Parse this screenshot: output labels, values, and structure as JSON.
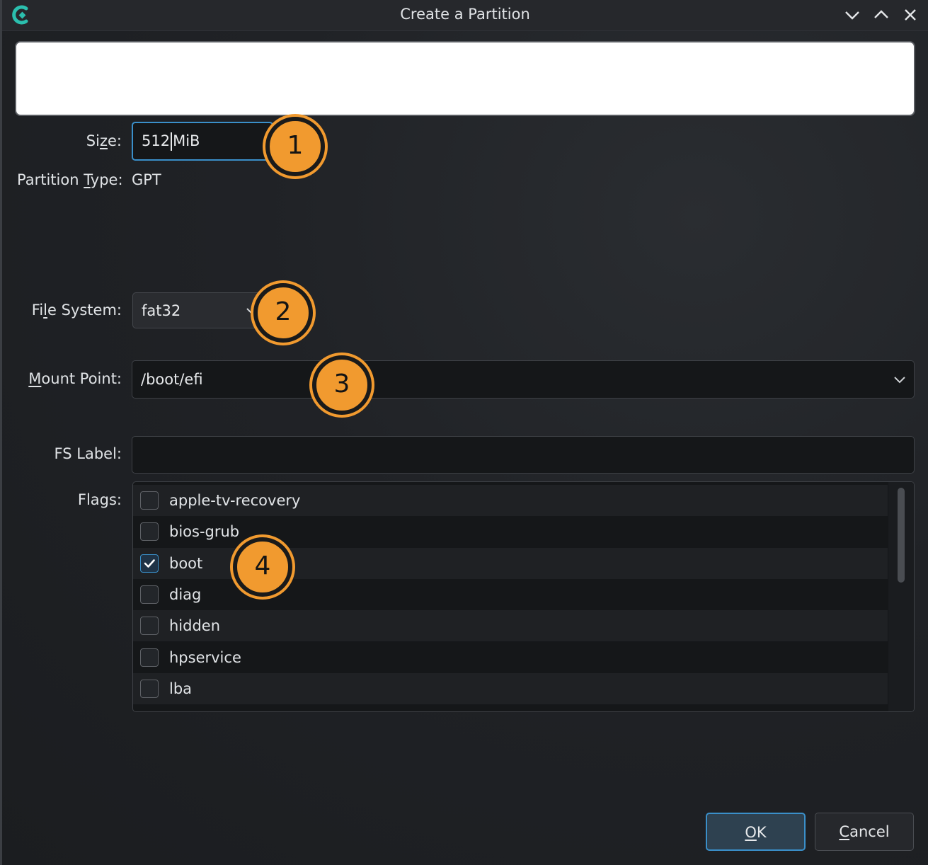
{
  "window": {
    "title": "Create a Partition",
    "accent_color": "#3a8fc9",
    "marker_color": "#f19a2f"
  },
  "form": {
    "size": {
      "label_pre": "Si",
      "label_u": "z",
      "label_post": "e:",
      "value": "512",
      "unit": "MiB"
    },
    "partition_type": {
      "label_pre": "Partition ",
      "label_u": "T",
      "label_post": "ype:",
      "value": "GPT"
    },
    "file_system": {
      "label_pre": "Fi",
      "label_u": "l",
      "label_post": "e System:",
      "value": "fat32"
    },
    "mount_point": {
      "label_pre": "",
      "label_u": "M",
      "label_post": "ount Point:",
      "value": "/boot/efi"
    },
    "fs_label": {
      "label": "FS Label:",
      "value": ""
    },
    "flags": {
      "label": "Flags:",
      "items": [
        {
          "name": "apple-tv-recovery",
          "checked": false
        },
        {
          "name": "bios-grub",
          "checked": false
        },
        {
          "name": "boot",
          "checked": true
        },
        {
          "name": "diag",
          "checked": false
        },
        {
          "name": "hidden",
          "checked": false
        },
        {
          "name": "hpservice",
          "checked": false
        },
        {
          "name": "lba",
          "checked": false
        }
      ]
    }
  },
  "buttons": {
    "ok": {
      "u": "O",
      "rest": "K"
    },
    "cancel": {
      "u": "C",
      "rest": "ancel"
    }
  },
  "markers": [
    "1",
    "2",
    "3",
    "4"
  ]
}
